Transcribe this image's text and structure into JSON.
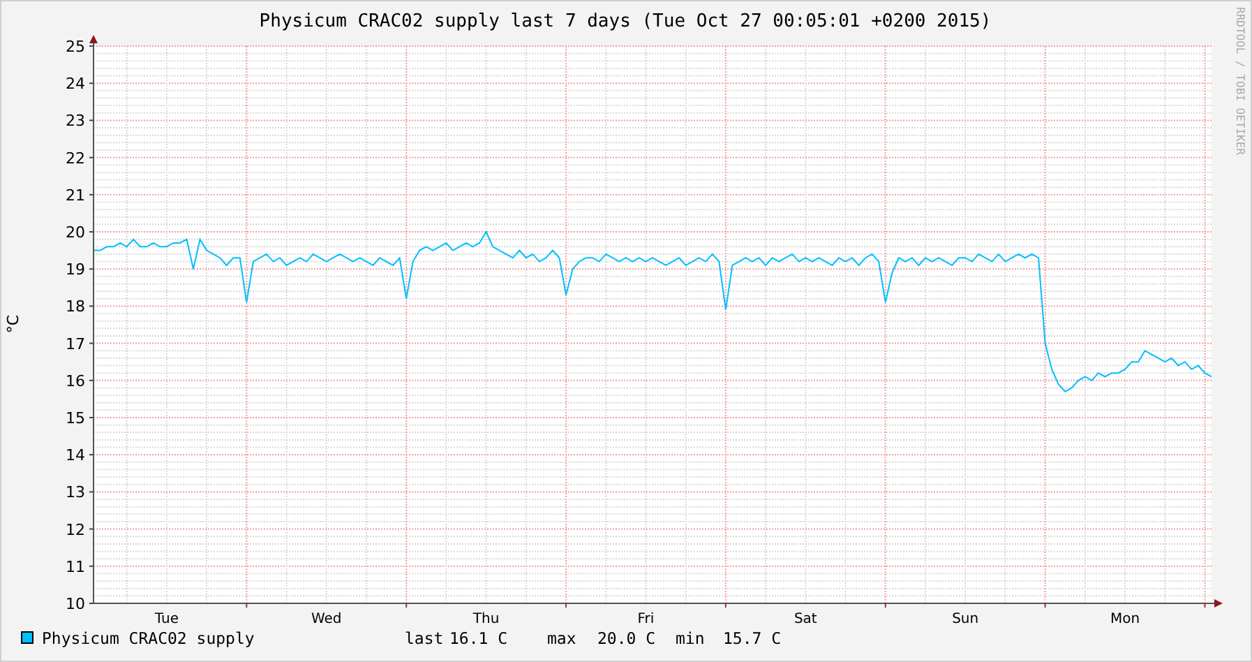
{
  "chart": {
    "chart_data": {
      "type": "line",
      "title": "Physicum CRAC02 supply last 7 days (Tue Oct 27 00:05:01 +0200 2015)",
      "ylabel": "°C",
      "grid": true,
      "ylim": [
        10,
        25
      ],
      "yticks": [
        10,
        11,
        12,
        13,
        14,
        15,
        16,
        17,
        18,
        19,
        20,
        21,
        22,
        23,
        24,
        25
      ],
      "series": [
        {
          "name": "Physicum CRAC02 supply",
          "color": "#00bfff",
          "values": [
            19.5,
            19.5,
            19.6,
            19.6,
            19.7,
            19.6,
            19.8,
            19.6,
            19.6,
            19.7,
            19.6,
            19.6,
            19.7,
            19.7,
            19.8,
            19.0,
            19.8,
            19.5,
            19.4,
            19.3,
            19.1,
            19.3,
            19.3,
            18.1,
            19.2,
            19.3,
            19.4,
            19.2,
            19.3,
            19.1,
            19.2,
            19.3,
            19.2,
            19.4,
            19.3,
            19.2,
            19.3,
            19.4,
            19.3,
            19.2,
            19.3,
            19.2,
            19.1,
            19.3,
            19.2,
            19.1,
            19.3,
            18.2,
            19.2,
            19.5,
            19.6,
            19.5,
            19.6,
            19.7,
            19.5,
            19.6,
            19.7,
            19.6,
            19.7,
            20.0,
            19.6,
            19.5,
            19.4,
            19.3,
            19.5,
            19.3,
            19.4,
            19.2,
            19.3,
            19.5,
            19.3,
            18.3,
            19.0,
            19.2,
            19.3,
            19.3,
            19.2,
            19.4,
            19.3,
            19.2,
            19.3,
            19.2,
            19.3,
            19.2,
            19.3,
            19.2,
            19.1,
            19.2,
            19.3,
            19.1,
            19.2,
            19.3,
            19.2,
            19.4,
            19.2,
            17.9,
            19.1,
            19.2,
            19.3,
            19.2,
            19.3,
            19.1,
            19.3,
            19.2,
            19.3,
            19.4,
            19.2,
            19.3,
            19.2,
            19.3,
            19.2,
            19.1,
            19.3,
            19.2,
            19.3,
            19.1,
            19.3,
            19.4,
            19.2,
            18.1,
            18.9,
            19.3,
            19.2,
            19.3,
            19.1,
            19.3,
            19.2,
            19.3,
            19.2,
            19.1,
            19.3,
            19.3,
            19.2,
            19.4,
            19.3,
            19.2,
            19.4,
            19.2,
            19.3,
            19.4,
            19.3,
            19.4,
            19.3,
            17.0,
            16.3,
            15.9,
            15.7,
            15.8,
            16.0,
            16.1,
            16.0,
            16.2,
            16.1,
            16.2,
            16.2,
            16.3,
            16.5,
            16.5,
            16.8,
            16.7,
            16.6,
            16.5,
            16.6,
            16.4,
            16.5,
            16.3,
            16.4,
            16.2,
            16.1
          ]
        }
      ]
    },
    "day_labels": [
      "Tue",
      "Wed",
      "Thu",
      "Fri",
      "Sat",
      "Sun",
      "Mon"
    ],
    "credit": "RRDTOOL / TOBI OETIKER",
    "stats": [
      {
        "label": "last",
        "value": "16.1 C"
      },
      {
        "label": "max",
        "value": "20.0 C"
      },
      {
        "label": "min",
        "value": "15.7 C"
      }
    ]
  }
}
